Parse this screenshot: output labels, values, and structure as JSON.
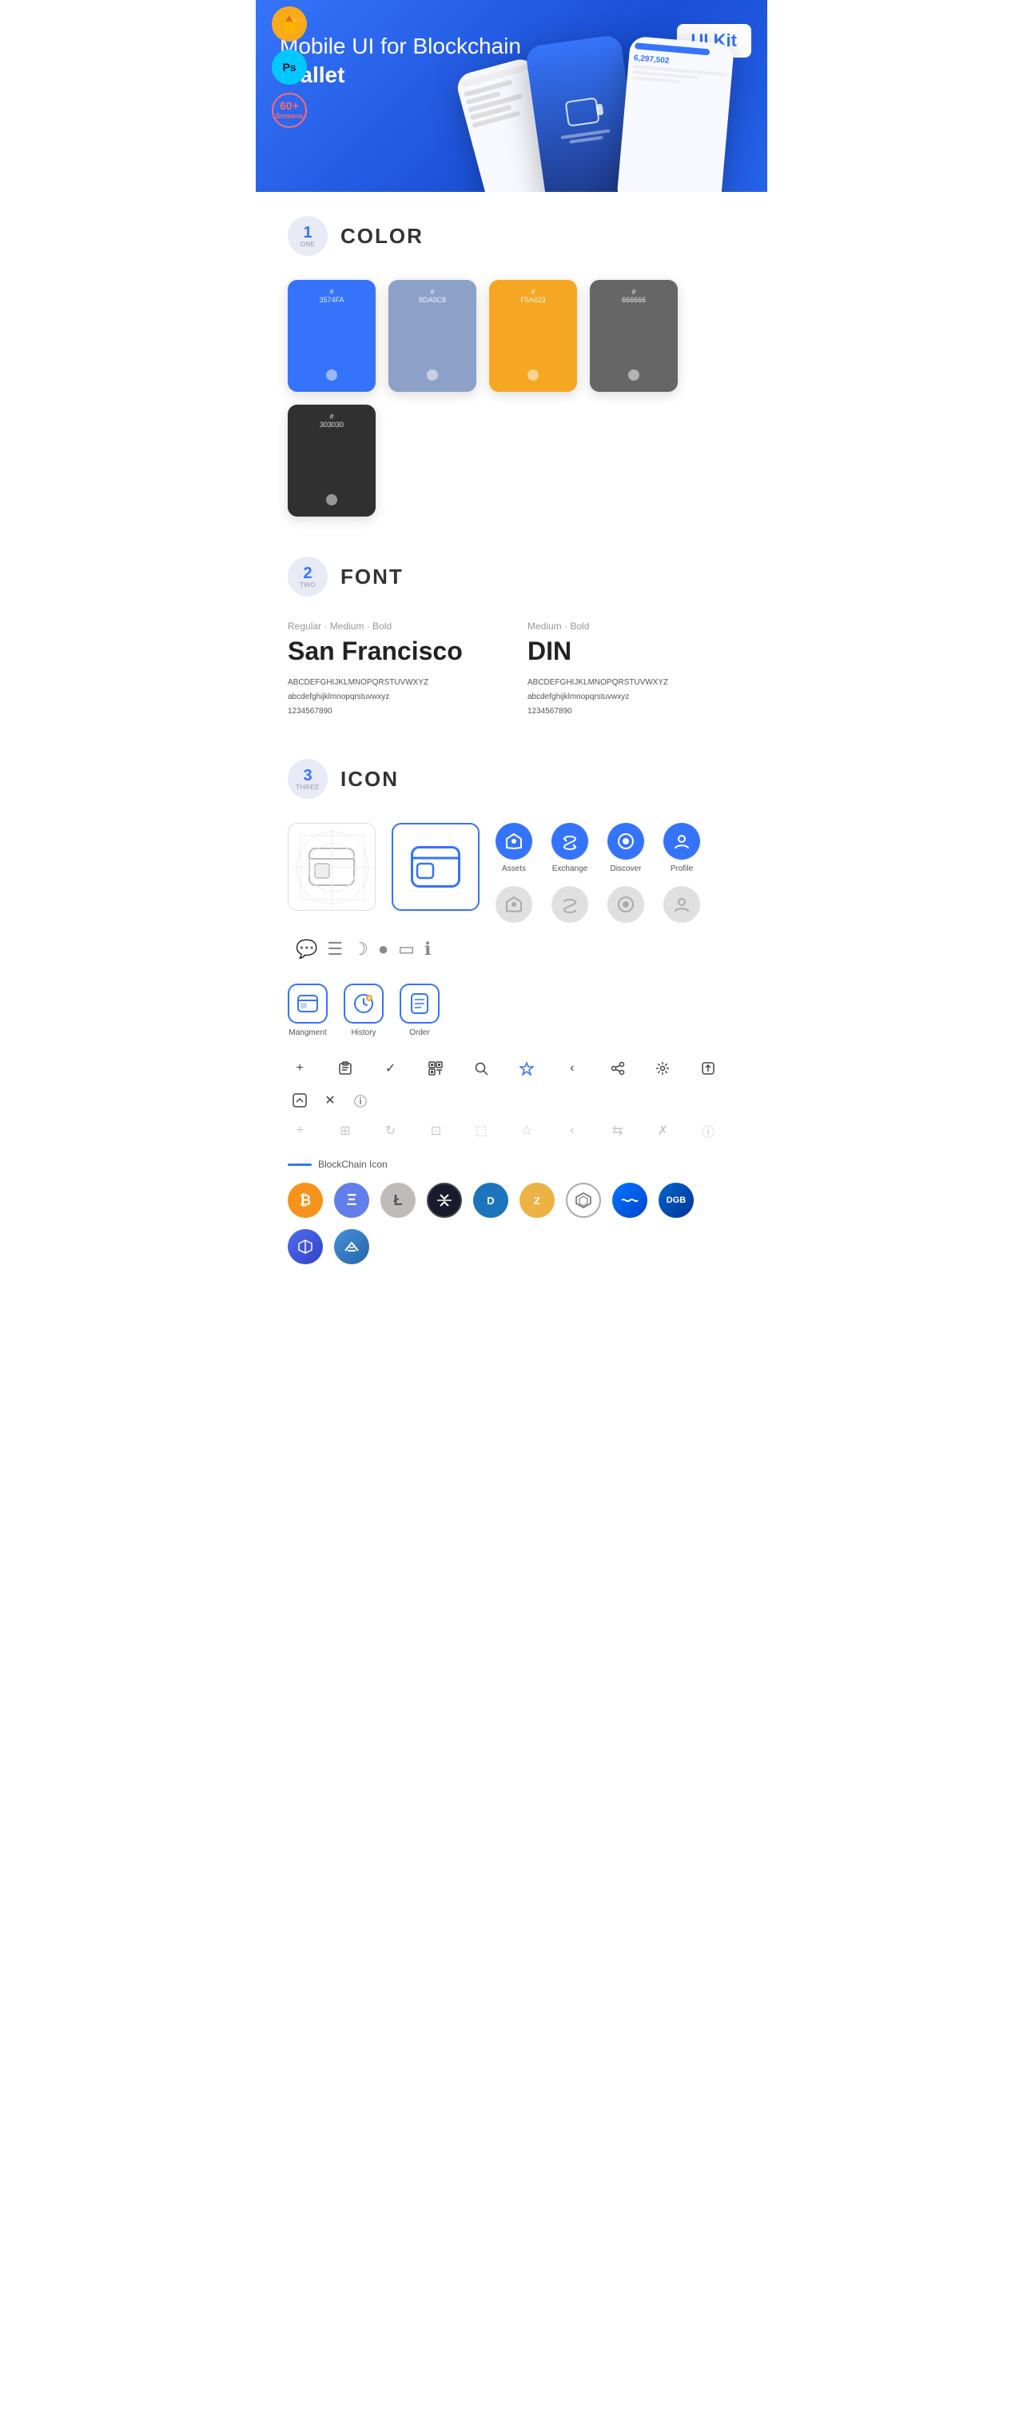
{
  "hero": {
    "title_normal": "Mobile UI for Blockchain ",
    "title_bold": "Wallet",
    "badge": "UI Kit",
    "badges": [
      {
        "id": "sketch",
        "label": "S",
        "type": "sketch"
      },
      {
        "id": "ps",
        "label": "Ps",
        "type": "ps"
      },
      {
        "id": "screens",
        "line1": "60+",
        "line2": "Screens",
        "type": "screens"
      }
    ]
  },
  "sections": {
    "color": {
      "number": "1",
      "word": "ONE",
      "title": "COLOR",
      "swatches": [
        {
          "hex": "#3574FA",
          "label": "#\n3574FA",
          "dot": true
        },
        {
          "hex": "#8D A0C8",
          "label": "#\n8DA0C8",
          "dot": true
        },
        {
          "hex": "#F5A623",
          "label": "#\nF5A623",
          "dot": true
        },
        {
          "hex": "#666666",
          "label": "#\n666666",
          "dot": true
        },
        {
          "hex": "#303030",
          "label": "#\n303030",
          "dot": true
        }
      ]
    },
    "font": {
      "number": "2",
      "word": "TWO",
      "title": "FONT",
      "fonts": [
        {
          "meta": "Regular · Medium · Bold",
          "name": "San Francisco",
          "type": "sf",
          "chars_upper": "ABCDEFGHIJKLMNOPQRSTUVWXYZ",
          "chars_lower": "abcdefghijklmnopqrstuvwxyz",
          "chars_num": "1234567890"
        },
        {
          "meta": "Medium · Bold",
          "name": "DIN",
          "type": "din",
          "chars_upper": "ABCDEFGHIJKLMNOPQRSTUVWXYZ",
          "chars_lower": "abcdefghijklmnopqrstuvwxyz",
          "chars_num": "1234567890"
        }
      ]
    },
    "icon": {
      "number": "3",
      "word": "THREE",
      "title": "ICON",
      "nav_icons": [
        {
          "label": "Assets",
          "active": true
        },
        {
          "label": "Exchange",
          "active": true
        },
        {
          "label": "Discover",
          "active": true
        },
        {
          "label": "Profile",
          "active": true
        },
        {
          "label": "",
          "active": false
        },
        {
          "label": "",
          "active": false
        },
        {
          "label": "",
          "active": false
        },
        {
          "label": "",
          "active": false
        }
      ],
      "app_icons": [
        {
          "label": "Mangment",
          "symbol": "⬜"
        },
        {
          "label": "History",
          "symbol": "🕐"
        },
        {
          "label": "Order",
          "symbol": "📋"
        }
      ],
      "small_icons": [
        "+",
        "⊞",
        "✓",
        "⊟",
        "🔍",
        "☆",
        "‹",
        "≺",
        "⚙",
        "⬜"
      ],
      "small_icons2": [
        "⬜",
        "⬛",
        "↻",
        "≺",
        "⊞",
        "☆",
        "‹",
        "⇆",
        "✗",
        "ℹ"
      ],
      "blockchain_label": "BlockChain Icon",
      "crypto_icons": [
        {
          "symbol": "₿",
          "class": "crypto-btc",
          "name": "Bitcoin"
        },
        {
          "symbol": "Ξ",
          "class": "crypto-eth",
          "name": "Ethereum"
        },
        {
          "symbol": "Ł",
          "class": "crypto-ltc",
          "name": "Litecoin"
        },
        {
          "symbol": "✦",
          "class": "crypto-xrp",
          "name": "Ripple"
        },
        {
          "symbol": "D",
          "class": "crypto-dash",
          "name": "Dash"
        },
        {
          "symbol": "Z",
          "class": "crypto-zcash",
          "name": "Zcash"
        },
        {
          "symbol": "⬡",
          "class": "crypto-grid-coin",
          "name": "GridCoin"
        },
        {
          "symbol": "W",
          "class": "crypto-waves",
          "name": "Waves"
        },
        {
          "symbol": "D",
          "class": "crypto-digibyte",
          "name": "DigiByte"
        },
        {
          "symbol": "~",
          "class": "crypto-band",
          "name": "Band"
        },
        {
          "symbol": "N",
          "class": "crypto-nano",
          "name": "Nano"
        }
      ]
    }
  }
}
